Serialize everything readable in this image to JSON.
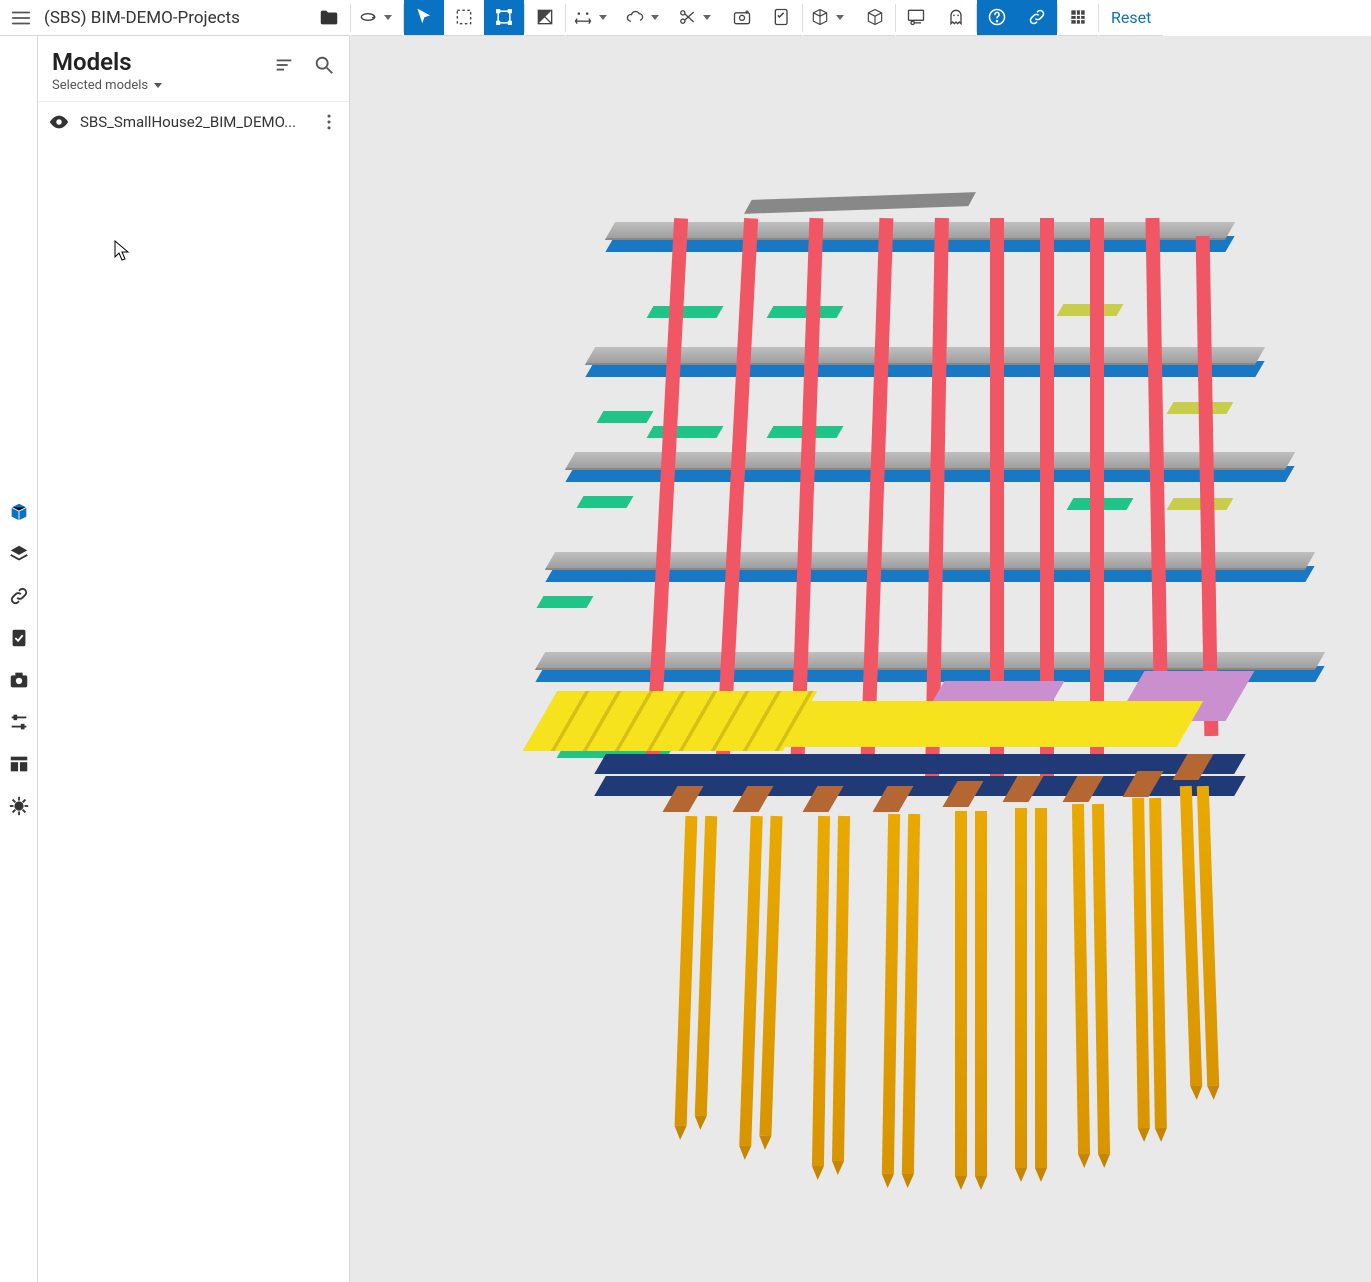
{
  "header": {
    "project_title": "(SBS) BIM-DEMO-Projects"
  },
  "toolbar": {
    "reset_label": "Reset"
  },
  "app_rail": {
    "items": [
      {
        "icon": "cube-icon",
        "active": true
      },
      {
        "icon": "layers-icon",
        "active": false
      },
      {
        "icon": "link-icon",
        "active": false
      },
      {
        "icon": "clipboard-check-icon",
        "active": false
      },
      {
        "icon": "camera-icon",
        "active": false
      },
      {
        "icon": "sliders-icon",
        "active": false
      },
      {
        "icon": "columns-icon",
        "active": false
      },
      {
        "icon": "bug-icon",
        "active": false
      }
    ]
  },
  "panel": {
    "title": "Models",
    "subtitle": "Selected models",
    "items": [
      {
        "name": "SBS_SmallHouse2_BIM_DEMO...",
        "visible": true
      }
    ]
  }
}
